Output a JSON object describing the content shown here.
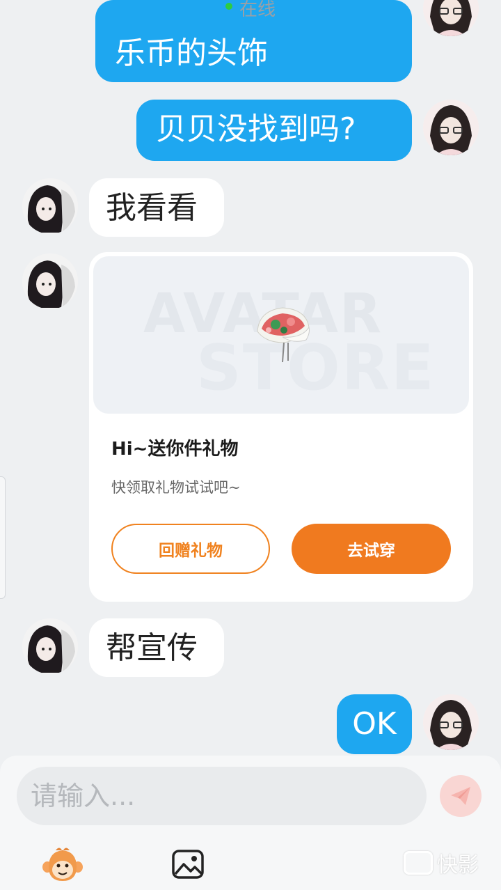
{
  "status": {
    "presence": "在线"
  },
  "messages": {
    "m1": "乐币的头饰",
    "m2": "贝贝没找到吗?",
    "m3": "我看看",
    "m5": "帮宣传",
    "m6": "OK"
  },
  "gift_card": {
    "watermark_top": "AVATAR",
    "watermark_bottom": "STORE",
    "title": "Hi~送你件礼物",
    "subtitle": "快领取礼物试试吧~",
    "return_gift": "回赠礼物",
    "try_on": "去试穿"
  },
  "composer": {
    "placeholder": "请输入...",
    "emoji_icon": "monkey-emoji-icon",
    "image_icon": "image-icon",
    "send_icon": "paper-plane-icon"
  },
  "watermark": {
    "app_name": "快影"
  },
  "colors": {
    "outgoing_bubble": "#1ea7f0",
    "accent_orange": "#f07a1f",
    "online_dot": "#2ecc40"
  }
}
